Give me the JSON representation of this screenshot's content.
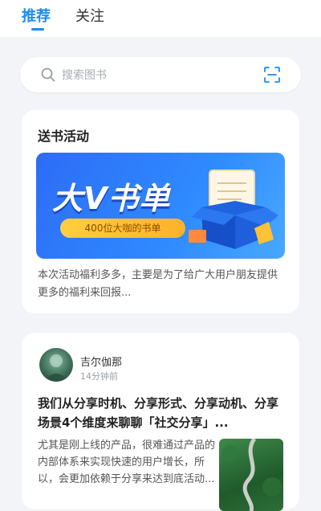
{
  "tabs": {
    "recommend": "推荐",
    "follow": "关注"
  },
  "search": {
    "placeholder": "搜索图书"
  },
  "activity": {
    "title": "送书活动",
    "banner_title": "大V书单",
    "banner_tag": "400位大咖的书单",
    "description": "本次活动福利多多，主要是为了给广大用户朋友提供更多的福利来回报..."
  },
  "post": {
    "author": "吉尔伽那",
    "time": "14分钟前",
    "title": "我们从分享时机、分享形式、分享动机、分享场景4个维度来聊聊「社交分享」...",
    "excerpt": "尤其是刚上线的产品，很难通过产品的内部体系来实现快速的用户增长，所以，会更加依赖于分享来达到底活动..."
  },
  "colors": {
    "accent": "#1a8bf0",
    "banner": "#2f8bff",
    "pill": "#ffc234"
  }
}
